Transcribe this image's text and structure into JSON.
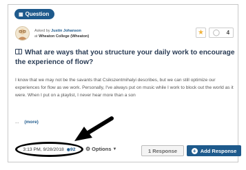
{
  "badge": {
    "label": "Question"
  },
  "asker": {
    "prefix": "Asked by",
    "name": "Justin Johanson",
    "at": "at",
    "school": "Wheaton College (Wheaton)"
  },
  "bulb_count": "4",
  "question": {
    "title": "What are ways that you structure your daily work to encourage the experience of flow?",
    "body": "I know that we may not be the savants that Csikszentmihalyi describes, but we can still optimize our experiences for flow as we work. Personally, I've always put on music while I work to block out the world as it were. When I put on a playlist, I never hear more than a son",
    "ellipsis": "...",
    "more_label": "(more)"
  },
  "meta": {
    "timestamp": "3:13 PM, 9/28/2018",
    "views": "92"
  },
  "options_label": "Options",
  "response_count_label": "1 Response",
  "add_response_label": "Add Response",
  "colors": {
    "brand": "#1e5a8c",
    "star": "#f0b23a",
    "title": "#2b3d56"
  },
  "icons": [
    "question-icon",
    "star-icon",
    "lightbulb-icon",
    "book-icon",
    "eye-icon",
    "gear-icon",
    "plus-icon",
    "arrow-annotation"
  ]
}
